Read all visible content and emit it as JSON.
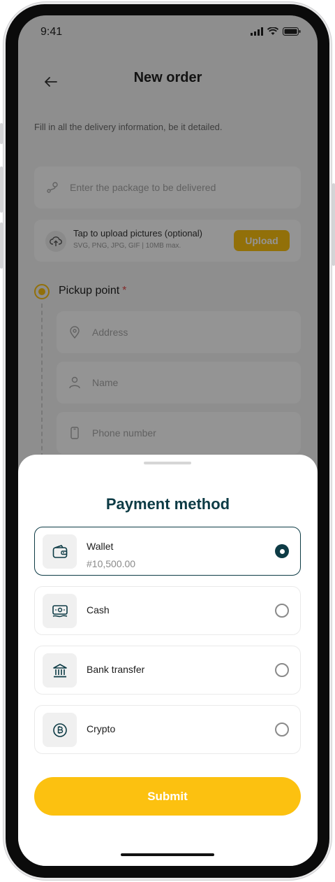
{
  "status_bar": {
    "time": "9:41"
  },
  "header": {
    "title": "New order"
  },
  "form": {
    "hint": "Fill in all the delivery information, be it detailed.",
    "package_placeholder": "Enter the package to be delivered",
    "upload": {
      "title": "Tap to upload pictures (optional)",
      "subtitle": "SVG, PNG, JPG, GIF | 10MB max.",
      "button": "Upload"
    },
    "pickup": {
      "label": "Pickup point",
      "required_mark": "*"
    },
    "address_placeholder": "Address",
    "name_placeholder": "Name",
    "phone_placeholder": "Phone number"
  },
  "payment_sheet": {
    "title": "Payment method",
    "options": [
      {
        "label": "Wallet",
        "sub": "#10,500.00",
        "icon": "wallet-icon",
        "selected": true
      },
      {
        "label": "Cash",
        "icon": "cash-icon",
        "selected": false
      },
      {
        "label": "Bank transfer",
        "icon": "bank-icon",
        "selected": false
      },
      {
        "label": "Crypto",
        "icon": "bitcoin-icon",
        "selected": false
      }
    ],
    "submit_label": "Submit"
  },
  "colors": {
    "accent": "#fcc110",
    "primary": "#0d3b45"
  }
}
